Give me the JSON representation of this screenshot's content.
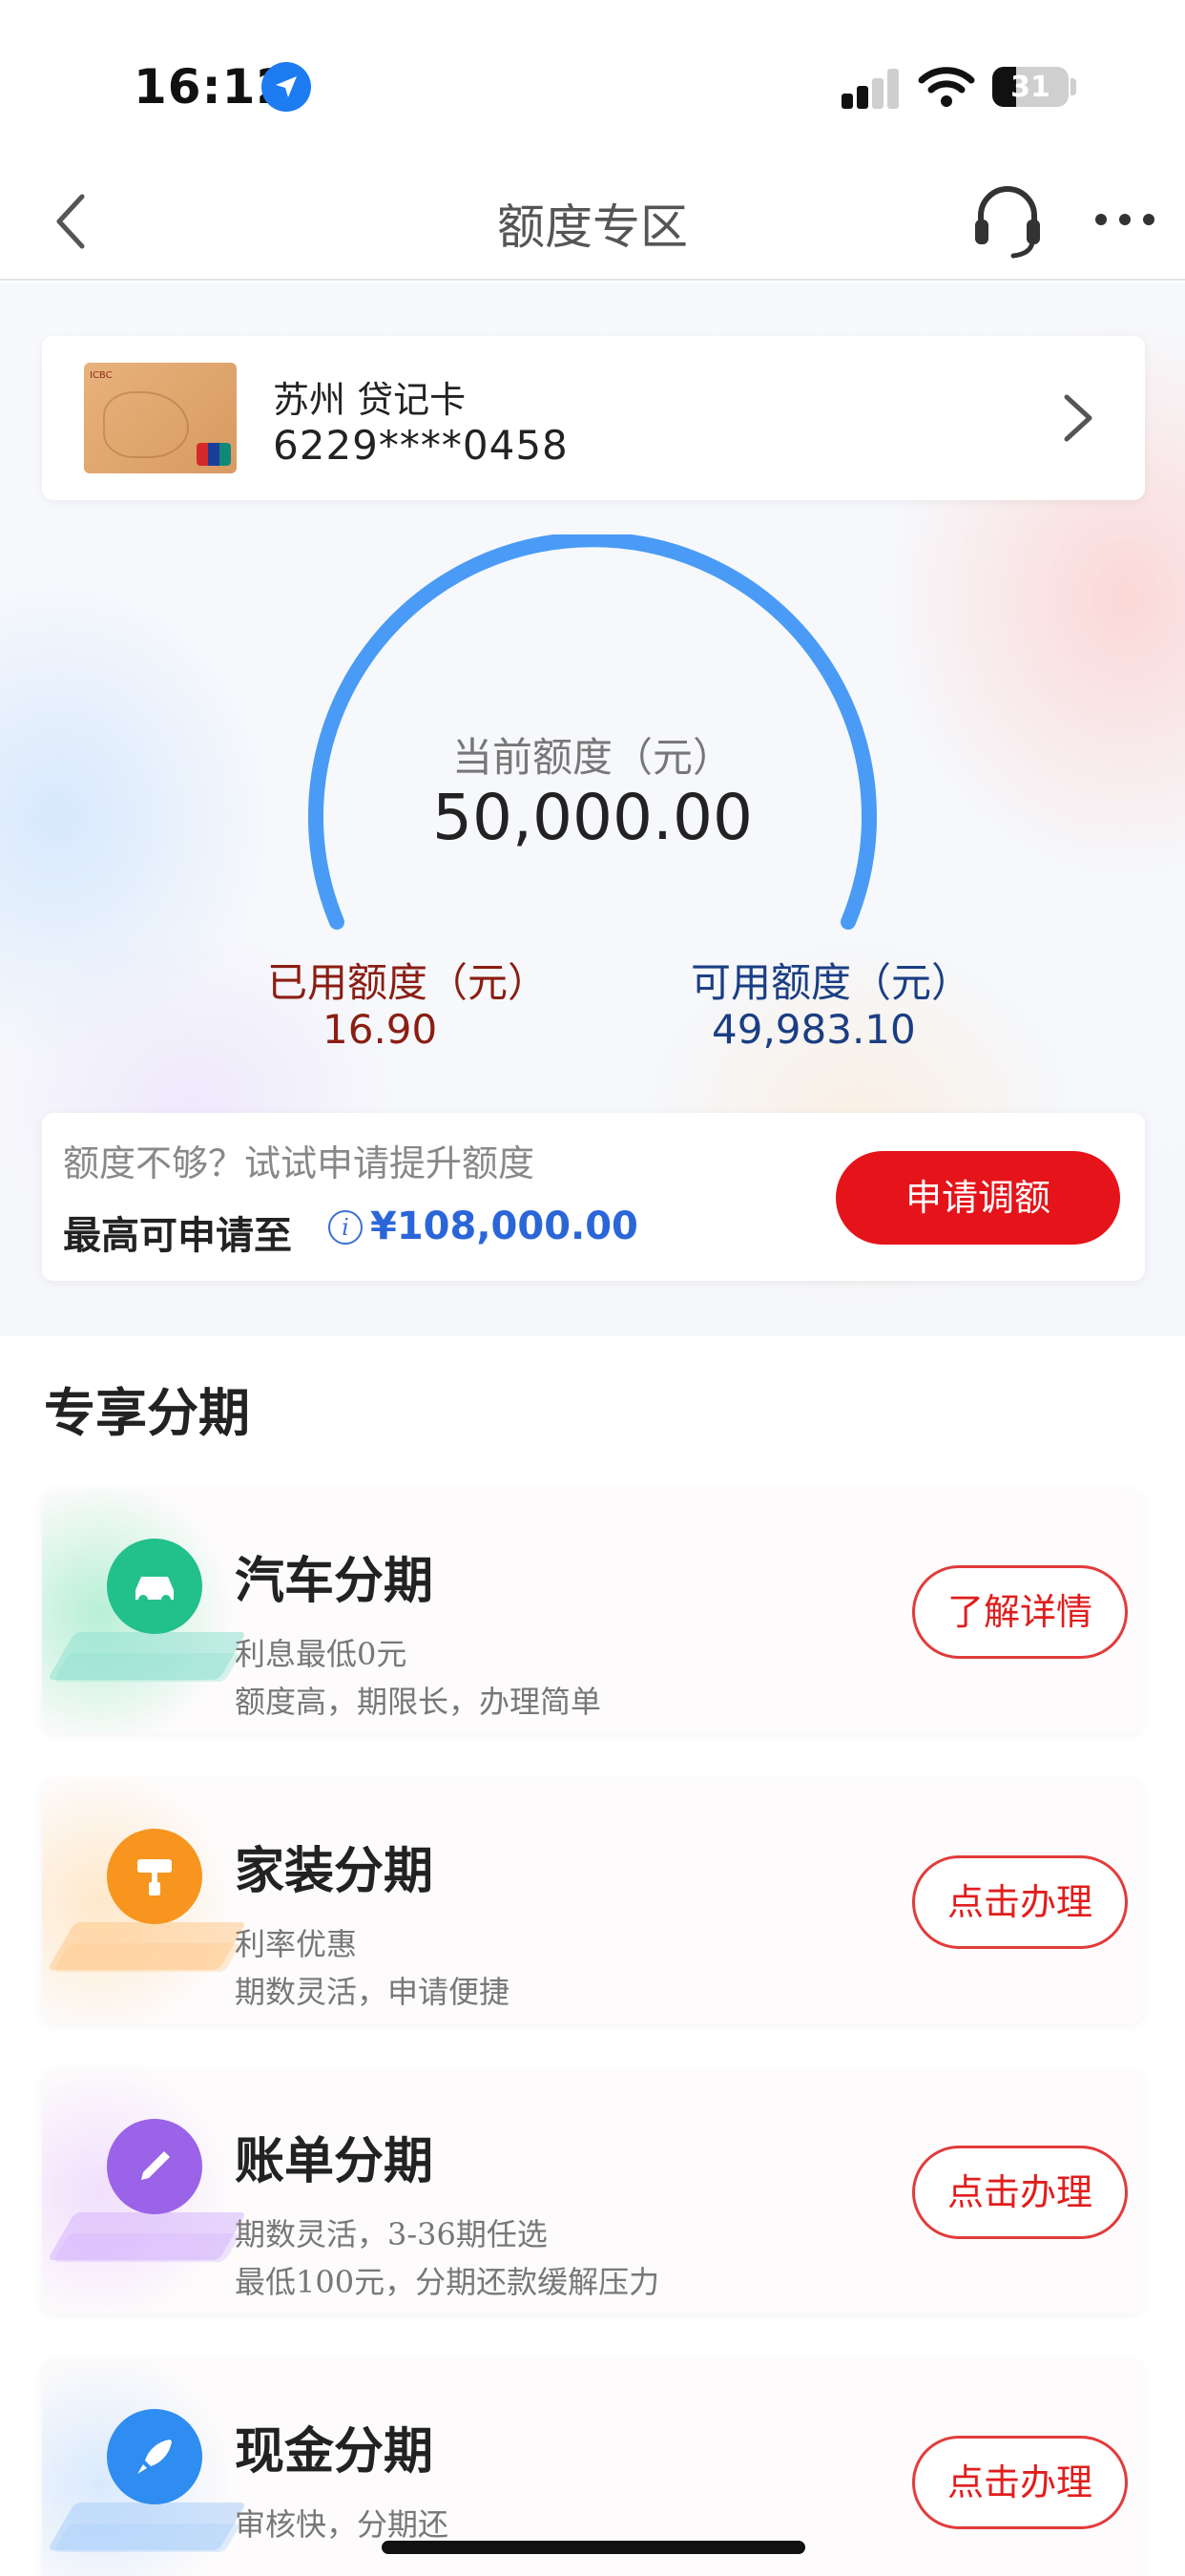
{
  "status_bar": {
    "time": "16:12",
    "battery": "31"
  },
  "nav": {
    "title": "额度专区"
  },
  "card": {
    "name": "苏州 贷记卡",
    "number": "6229****0458"
  },
  "limit": {
    "current_label": "当前额度（元）",
    "current_value": "50,000.00",
    "used_label": "已用额度（元）",
    "used_value": "16.90",
    "available_label": "可用额度（元）",
    "available_value": "49,983.10",
    "used_fraction": 0.000338
  },
  "raise": {
    "hint": "额度不够？试试申请提升额度",
    "max_label": "最高可申请至",
    "max_value": "¥108,000.00",
    "button": "申请调额"
  },
  "section_title": "专享分期",
  "plans": [
    {
      "title": "汽车分期",
      "line1": "利息最低0元",
      "line2": "额度高，期限长，办理简单",
      "button": "了解详情",
      "icon": "car-icon",
      "color": "#22c08a"
    },
    {
      "title": "家装分期",
      "line1": "利率优惠",
      "line2": "期数灵活，申请便捷",
      "button": "点击办理",
      "icon": "paint-roller-icon",
      "color": "#f7951e"
    },
    {
      "title": "账单分期",
      "line1": "期数灵活，3-36期任选",
      "line2": "最低100元，分期还款缓解压力",
      "button": "点击办理",
      "icon": "pen-icon",
      "color": "#9a63e8"
    },
    {
      "title": "现金分期",
      "line1": "审核快，分期还",
      "line2": "",
      "button": "点击办理",
      "icon": "rocket-icon",
      "color": "#2f8cf0"
    }
  ],
  "colors": {
    "accent_red": "#e5141a",
    "gauge_blue": "#4a9bf5",
    "used_red": "#8a1e12",
    "available_blue": "#1a3e83"
  }
}
